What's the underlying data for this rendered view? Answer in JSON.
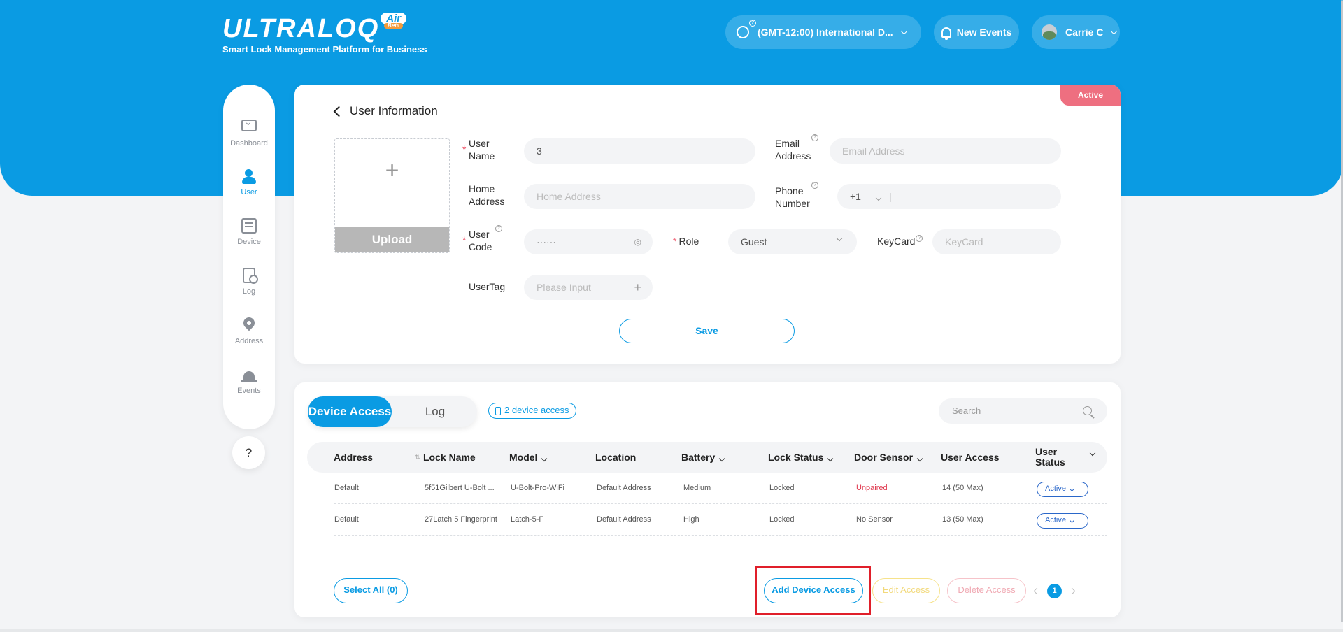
{
  "header": {
    "brand": "ULTRALOQ",
    "brand_badge": "Air",
    "brand_beta": "Beta",
    "tagline": "Smart Lock Management Platform for Business",
    "timezone": "(GMT-12:00) International D...",
    "new_events": "New Events",
    "user_name": "Carrie C"
  },
  "sidebar": {
    "items": [
      {
        "label": "Dashboard",
        "icon": "dashboard-icon"
      },
      {
        "label": "User",
        "icon": "user-icon",
        "active": true
      },
      {
        "label": "Device",
        "icon": "device-icon"
      },
      {
        "label": "Log",
        "icon": "log-icon"
      },
      {
        "label": "Address",
        "icon": "location-pin-icon"
      },
      {
        "label": "Events",
        "icon": "alarm-icon"
      }
    ],
    "help": "?"
  },
  "user_info": {
    "title": "User Information",
    "status": "Active",
    "upload_plus": "+",
    "upload_label": "Upload",
    "fields": {
      "user_name_label": "User Name",
      "user_name_value": "3",
      "email_label": "Email Address",
      "email_placeholder": "Email Address",
      "home_label": "Home Address",
      "home_placeholder": "Home Address",
      "phone_label": "Phone Number",
      "phone_code": "+1",
      "phone_value": "|",
      "user_code_label": "User Code",
      "user_code_value": "······",
      "role_label": "Role",
      "role_value": "Guest",
      "keycard_label": "KeyCard",
      "keycard_placeholder": "KeyCard",
      "usertag_label": "UserTag",
      "usertag_placeholder": "Please Input",
      "usertag_add": "+"
    },
    "save": "Save"
  },
  "access": {
    "tabs": [
      "Device Access",
      "Log"
    ],
    "device_count": "2 device access",
    "search_placeholder": "Search",
    "columns": [
      "Address",
      "Lock Name",
      "Model",
      "Location",
      "Battery",
      "Lock Status",
      "Door Sensor",
      "User Access",
      "User Status"
    ],
    "rows": [
      {
        "address": "Default",
        "lock": "5f51Gilbert U-Bolt ...",
        "model": "U-Bolt-Pro-WiFi",
        "location": "Default Address",
        "battery": "Medium",
        "lock_status": "Locked",
        "door": "Unpaired",
        "user_access": "14 (50 Max)",
        "status": "Active"
      },
      {
        "address": "Default",
        "lock": "27Latch 5 Fingerprint",
        "model": "Latch-5-F",
        "location": "Default Address",
        "battery": "High",
        "lock_status": "Locked",
        "door": "No Sensor",
        "user_access": "13 (50 Max)",
        "status": "Active"
      }
    ],
    "select_all": "Select All (0)",
    "add": "Add Device Access",
    "edit": "Edit Access",
    "delete": "Delete Access",
    "page": "1"
  },
  "colors": {
    "primary": "#0a9be3",
    "active_badge": "#ee6f80",
    "unpaired": "#e0394f",
    "highlight": "#e01f2a"
  }
}
